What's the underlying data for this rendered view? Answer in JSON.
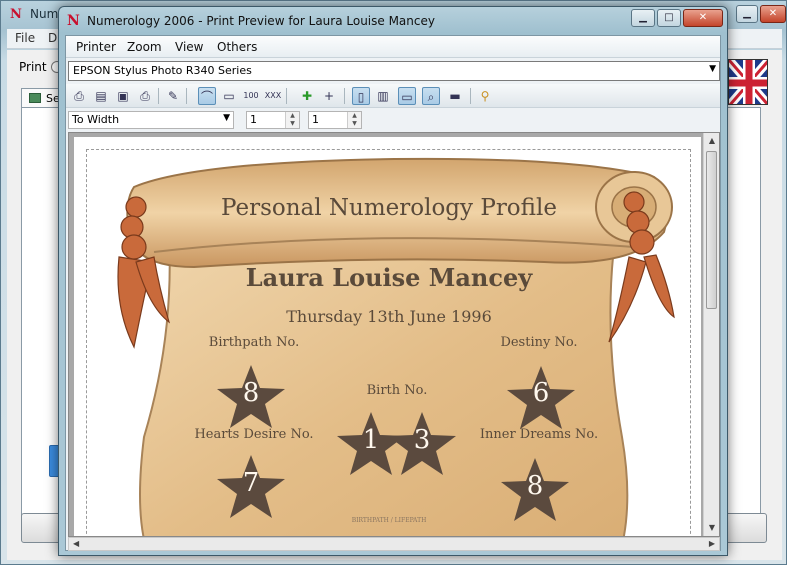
{
  "background_window": {
    "title": "Num",
    "menu": [
      "File",
      "D"
    ],
    "print_label": "Print",
    "tab_label": "Se"
  },
  "dialog": {
    "title": "Numerology 2006 - Print Preview for Laura Louise Mancey",
    "app_icon_letter": "N",
    "menu": {
      "printer": "Printer",
      "zoom": "Zoom",
      "view": "View",
      "others": "Others"
    },
    "printer_select": "EPSON Stylus Photo R340 Series",
    "toolbar": {
      "zoom_100": "100",
      "zoom_xxx": "XXX"
    },
    "zoom_mode": "To Width",
    "pages_across": "1",
    "pages_down": "1"
  },
  "profile": {
    "heading": "Personal Numerology Profile",
    "name": "Laura Louise Mancey",
    "date": "Thursday 13th June 1996",
    "birthpath_label": "Birthpath No.",
    "birthpath_value": "8",
    "destiny_label": "Destiny No.",
    "destiny_value": "6",
    "birth_label": "Birth No.",
    "birth_value_1": "1",
    "birth_value_2": "3",
    "hearts_label": "Hearts Desire No.",
    "hearts_value": "7",
    "inner_label": "Inner Dreams No.",
    "inner_value": "8",
    "footer": "BIRTHPATH / LIFEPATH"
  },
  "colors": {
    "scroll_parchment": "#e9c99a",
    "scroll_edge": "#a88358",
    "rope": "#c96a3b",
    "star": "#5b4a3e",
    "text": "#5a4a3a"
  }
}
